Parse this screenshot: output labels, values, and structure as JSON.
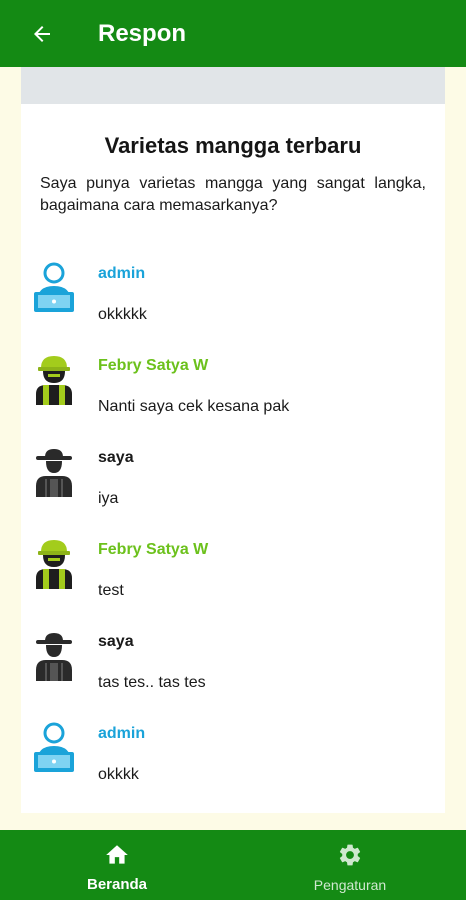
{
  "appbar": {
    "title": "Respon",
    "back_icon": "arrow-left-icon"
  },
  "post": {
    "title": "Varietas mangga terbaru",
    "body": "Saya punya varietas mangga yang sangat langka, bagaimana cara memasarkanya?"
  },
  "colors": {
    "primary": "#148a14",
    "admin_name": "#1aa3d9",
    "expert_name": "#6cc11c",
    "self_name": "#1a1a1a",
    "page_bg": "#fdfbe6"
  },
  "comments": [
    {
      "name": "admin",
      "text": "okkkkk",
      "role": "admin",
      "avatar_icon": "admin-laptop-avatar-icon"
    },
    {
      "name": "Febry Satya W",
      "text": "Nanti saya cek kesana pak",
      "role": "expert",
      "avatar_icon": "helmet-worker-avatar-icon"
    },
    {
      "name": "saya",
      "text": "iya",
      "role": "self",
      "avatar_icon": "farmer-hat-avatar-icon"
    },
    {
      "name": "Febry Satya W",
      "text": "test",
      "role": "expert",
      "avatar_icon": "helmet-worker-avatar-icon"
    },
    {
      "name": "saya",
      "text": "tas tes.. tas tes",
      "role": "self",
      "avatar_icon": "farmer-hat-avatar-icon"
    },
    {
      "name": "admin",
      "text": "okkkk",
      "role": "admin",
      "avatar_icon": "admin-laptop-avatar-icon"
    }
  ],
  "bottom_nav": {
    "home": {
      "label": "Beranda",
      "icon": "home-icon",
      "active": true
    },
    "settings": {
      "label": "Pengaturan",
      "icon": "gear-icon",
      "active": false
    }
  }
}
